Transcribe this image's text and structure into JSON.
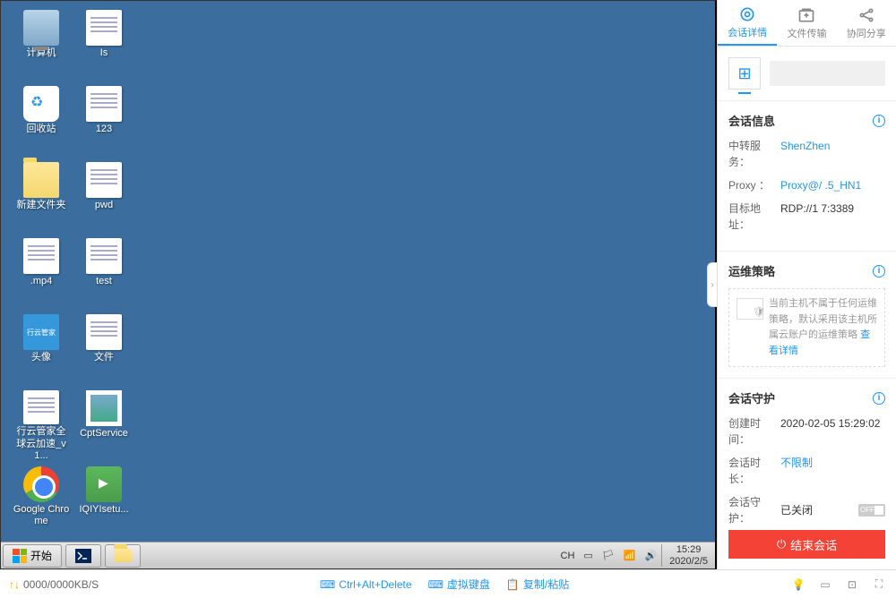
{
  "desktop": {
    "icons": [
      [
        {
          "name": "computer",
          "label": "计算机",
          "type": "computer"
        },
        {
          "name": "file-is",
          "label": "Is",
          "type": "file"
        }
      ],
      [
        {
          "name": "recycle-bin",
          "label": "回收站",
          "type": "bin"
        },
        {
          "name": "file-123",
          "label": "123",
          "type": "file"
        }
      ],
      [
        {
          "name": "new-folder",
          "label": "新建文件夹",
          "type": "folder"
        },
        {
          "name": "file-pwd",
          "label": "pwd",
          "type": "file"
        }
      ],
      [
        {
          "name": "file-mp4",
          "label": ".mp4",
          "type": "file"
        },
        {
          "name": "file-test",
          "label": "test",
          "type": "file"
        }
      ],
      [
        {
          "name": "avatar",
          "label": "头像",
          "type": "app"
        },
        {
          "name": "file-docs",
          "label": "文件",
          "type": "file"
        }
      ],
      [
        {
          "name": "xingyun",
          "label": "行云管家全球云加速_v1...",
          "type": "file"
        },
        {
          "name": "cptservice",
          "label": "CptService",
          "type": "img"
        }
      ],
      [
        {
          "name": "chrome",
          "label": "Google Chrome",
          "type": "chrome"
        },
        {
          "name": "iqiyi",
          "label": "IQIYIsetu...",
          "type": "iqiyi"
        }
      ]
    ]
  },
  "taskbar": {
    "start": "开始",
    "ime": "CH",
    "time": "15:29",
    "date": "2020/2/5"
  },
  "sidebar": {
    "tabs": [
      {
        "id": "details",
        "label": "会话详情",
        "active": true
      },
      {
        "id": "transfer",
        "label": "文件传输",
        "active": false
      },
      {
        "id": "share",
        "label": "协同分享",
        "active": false
      }
    ],
    "session_info": {
      "title": "会话信息",
      "relay_label": "中转服务：",
      "relay_value": "ShenZhen",
      "proxy_label": "Proxy   ：",
      "proxy_value": "Proxy@/               .5_HN1",
      "target_label": "目标地址：",
      "target_value": "RDP://1                7:3389"
    },
    "policy": {
      "title": "运维策略",
      "text": "当前主机不属于任何运维策略，默认采用该主机所属云账户的运维策略 ",
      "link": "查看详情"
    },
    "guard": {
      "title": "会话守护",
      "create_label": "创建时间：",
      "create_value": "2020-02-05 15:29:02",
      "duration_label": "会话时长：",
      "duration_value": "不限制",
      "guard_label": "会话守护：",
      "guard_value": "已关闭",
      "toggle": "OFF"
    },
    "end_button": "结束会话"
  },
  "bottombar": {
    "net": "0000/0000KB/S",
    "actions": [
      {
        "id": "cad",
        "label": "Ctrl+Alt+Delete"
      },
      {
        "id": "vkb",
        "label": "虚拟键盘"
      },
      {
        "id": "paste",
        "label": "复制/粘贴"
      }
    ]
  }
}
